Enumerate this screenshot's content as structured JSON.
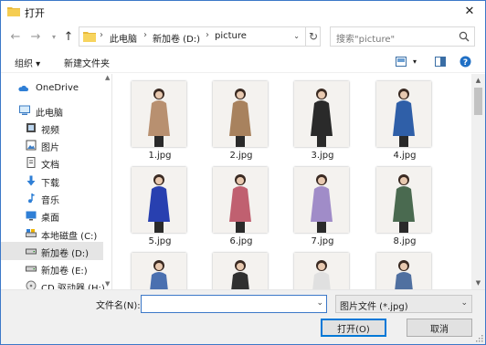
{
  "window": {
    "title": "打开"
  },
  "address": {
    "crumbs": [
      "此电脑",
      "新加卷 (D:)",
      "picture"
    ],
    "search_placeholder": "搜索\"picture\""
  },
  "toolbar": {
    "organize_label": "组织 ▾",
    "new_folder_label": "新建文件夹"
  },
  "sidebar": {
    "items": [
      {
        "label": "OneDrive",
        "icon": "cloud-icon"
      },
      {
        "label": "此电脑",
        "icon": "computer-icon"
      },
      {
        "label": "视频",
        "icon": "video-icon"
      },
      {
        "label": "图片",
        "icon": "picture-icon"
      },
      {
        "label": "文档",
        "icon": "document-icon"
      },
      {
        "label": "下载",
        "icon": "download-icon"
      },
      {
        "label": "音乐",
        "icon": "music-icon"
      },
      {
        "label": "桌面",
        "icon": "desktop-icon"
      },
      {
        "label": "本地磁盘 (C:)",
        "icon": "drive-icon"
      },
      {
        "label": "新加卷 (D:)",
        "icon": "drive-icon",
        "selected": true
      },
      {
        "label": "新加卷 (E:)",
        "icon": "drive-icon"
      },
      {
        "label": "CD 驱动器 (H:)",
        "icon": "cd-drive-icon"
      }
    ]
  },
  "files": [
    {
      "name": "1.jpg",
      "color": "#b89070"
    },
    {
      "name": "2.jpg",
      "color": "#a8825e"
    },
    {
      "name": "3.jpg",
      "color": "#2a2a2a"
    },
    {
      "name": "4.jpg",
      "color": "#2f5fa8"
    },
    {
      "name": "5.jpg",
      "color": "#2840b0"
    },
    {
      "name": "6.jpg",
      "color": "#c06070"
    },
    {
      "name": "7.jpg",
      "color": "#a08cc8"
    },
    {
      "name": "8.jpg",
      "color": "#4a6a50"
    },
    {
      "name": "",
      "color": "#4a70b0"
    },
    {
      "name": "",
      "color": "#303030"
    },
    {
      "name": "",
      "color": "#e0e0e0"
    },
    {
      "name": "",
      "color": "#5070a0"
    }
  ],
  "footer": {
    "filename_label": "文件名(N):",
    "filename_value": "",
    "filetype_value": "图片文件 (*.jpg)",
    "open_label": "打开(O)",
    "cancel_label": "取消"
  }
}
